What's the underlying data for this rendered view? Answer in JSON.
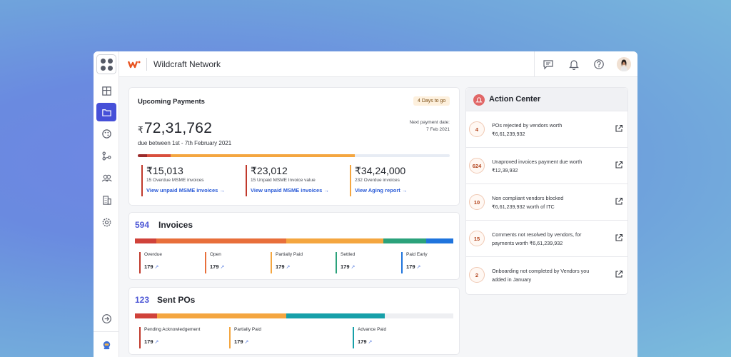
{
  "app": {
    "brand": "Wildcraft Network"
  },
  "topbar": {
    "icons": [
      "chat-icon",
      "bell-icon",
      "help-icon"
    ]
  },
  "sidebar": {
    "items": [
      "dashboard-icon",
      "folder-icon",
      "palette-icon",
      "workflow-icon",
      "users-icon",
      "building-icon",
      "settings-icon",
      "arrow-right-circle-icon",
      "bot-icon"
    ]
  },
  "upcoming": {
    "title": "Upcoming Payments",
    "badge": "4 Days to go",
    "amount_symbol": "₹",
    "amount": "72,31,762",
    "due_text": "due between 1st - 7th February 2021",
    "next_label": "Next payment date:",
    "next_date": "7 Feb 2021",
    "progress": [
      {
        "color": "#9b2b2b",
        "share": 0.03
      },
      {
        "color": "#d94f3d",
        "share": 0.075
      },
      {
        "color": "#f4a640",
        "share": 0.59
      },
      {
        "color": "#e7ecf4",
        "share": 0.305
      }
    ],
    "stats": [
      {
        "amount": "₹15,013",
        "desc": "15 Overdue MSME invoices",
        "link": "View unpaid MSME invoices",
        "color": "#c0392b"
      },
      {
        "amount": "₹23,012",
        "desc": "15 Unpaid MSME Invoice value",
        "link": "View unpaid MSME invoices",
        "color": "#c0392b"
      },
      {
        "amount": "₹34,24,000",
        "desc": "232 Overdue invoices",
        "link": "View Aging report",
        "color": "#f4a640"
      }
    ]
  },
  "invoices": {
    "count": "594",
    "title": "Invoices",
    "segments": [
      {
        "color": "#d0423a",
        "share": 0.07
      },
      {
        "color": "#e86f3b",
        "share": 0.43
      },
      {
        "color": "#f4a640",
        "share": 0.32
      },
      {
        "color": "#2ba27b",
        "share": 0.14
      },
      {
        "color": "#1f74dd",
        "share": 0.09
      }
    ],
    "legend": [
      {
        "label": "Overdue",
        "value": "179",
        "color": "#c0392b"
      },
      {
        "label": "Open",
        "value": "179",
        "color": "#e86f3b"
      },
      {
        "label": "Partially Paid",
        "value": "179",
        "color": "#f4a640"
      },
      {
        "label": "Settled",
        "value": "179",
        "color": "#2ba27b"
      },
      {
        "label": "Paid Early",
        "value": "179",
        "color": "#1f74dd"
      }
    ]
  },
  "pos": {
    "count": "123",
    "title": "Sent POs",
    "segments": [
      {
        "color": "#d0423a",
        "share": 0.07
      },
      {
        "color": "#f4a640",
        "share": 0.405
      },
      {
        "color": "#17a0a9",
        "share": 0.31
      },
      {
        "color": "#eeeff2",
        "share": 0.215
      }
    ],
    "legend": [
      {
        "label": "Pending Acknowledgement",
        "value": "179",
        "color": "#c0392b"
      },
      {
        "label": "Partially Paid",
        "value": "179",
        "color": "#f4a640"
      },
      {
        "label": "Advance Paid",
        "value": "179",
        "color": "#17a0a9"
      }
    ]
  },
  "action_center": {
    "title": "Action Center",
    "rows": [
      {
        "num": "4",
        "line1": "POs rejected by vendors worth",
        "line2": "₹6,61,239,932"
      },
      {
        "num": "624",
        "line1": "Unaproved invoices payment due worth",
        "line2": "₹12,39,932"
      },
      {
        "num": "10",
        "line1": "Non compliant vendors blocked",
        "line2": "₹6,61,239,932 worth of ITC"
      },
      {
        "num": "15",
        "line1": "Comments not resolved by vendors, for",
        "line2": "payments worth ₹6,61,239,932"
      },
      {
        "num": "2",
        "line1": "Onboarding not completed by Vendors you",
        "line2": "added in January"
      }
    ]
  }
}
